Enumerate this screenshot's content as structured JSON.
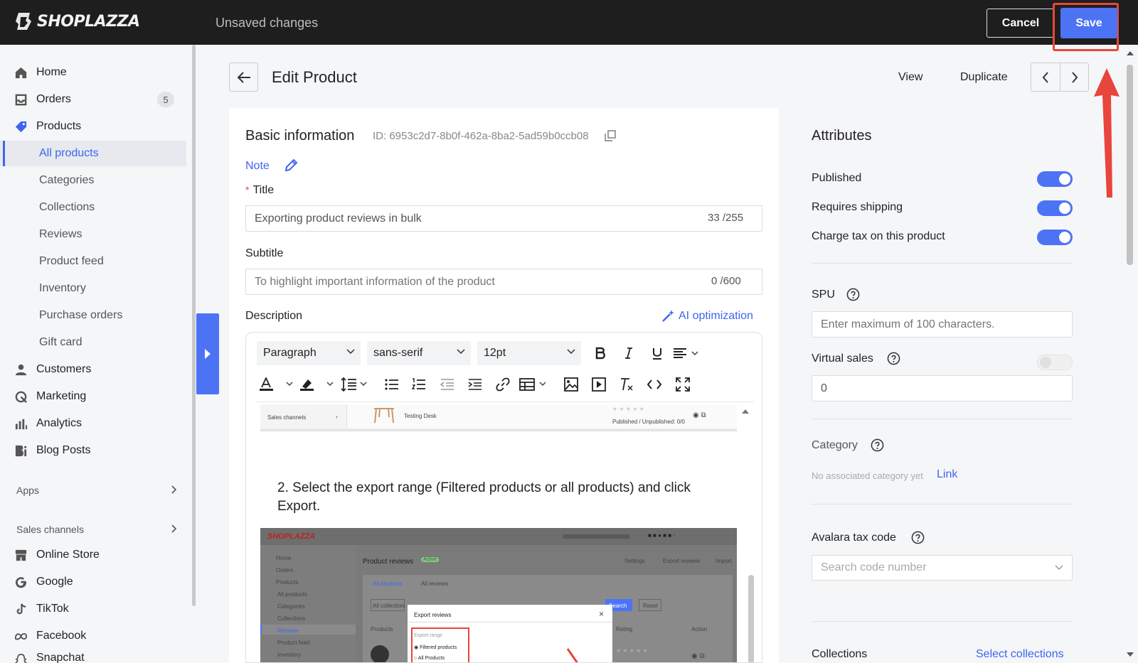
{
  "topbar": {
    "logo_text": "SHOPLAZZA",
    "status": "Unsaved changes",
    "cancel_label": "Cancel",
    "save_label": "Save"
  },
  "sidebar": {
    "items": [
      {
        "label": "Home",
        "icon": "home-icon"
      },
      {
        "label": "Orders",
        "icon": "orders-icon",
        "badge": "5"
      },
      {
        "label": "Products",
        "icon": "tag-icon"
      }
    ],
    "product_subitems": [
      "All products",
      "Categories",
      "Collections",
      "Reviews",
      "Product feed",
      "Inventory",
      "Purchase orders",
      "Gift card"
    ],
    "items2": [
      {
        "label": "Customers",
        "icon": "person-icon"
      },
      {
        "label": "Marketing",
        "icon": "marketing-icon"
      },
      {
        "label": "Analytics",
        "icon": "analytics-icon"
      },
      {
        "label": "Blog Posts",
        "icon": "blog-icon"
      }
    ],
    "apps_label": "Apps",
    "sales_channels_label": "Sales channels",
    "channels": [
      {
        "label": "Online Store",
        "icon": "store-icon"
      },
      {
        "label": "Google",
        "icon": "google-icon"
      },
      {
        "label": "TikTok",
        "icon": "tiktok-icon"
      },
      {
        "label": "Facebook",
        "icon": "meta-icon"
      },
      {
        "label": "Snapchat",
        "icon": "snapchat-icon"
      }
    ]
  },
  "header": {
    "title": "Edit Product",
    "view_label": "View",
    "duplicate_label": "Duplicate"
  },
  "basic": {
    "title": "Basic information",
    "id_text": "ID: 6953c2d7-8b0f-462a-8ba2-5ad59b0ccb08",
    "note_label": "Note",
    "title_label": "Title",
    "title_value": "Exporting product reviews in bulk",
    "title_counter": "33 /255",
    "subtitle_label": "Subtitle",
    "subtitle_placeholder": "To highlight important information of the product",
    "subtitle_counter": "0 /600",
    "description_label": "Description",
    "ai_label": "AI optimization"
  },
  "editor": {
    "paragraph_format": "Paragraph",
    "font_family": "sans-serif",
    "font_size": "12pt",
    "step_text": "2. Select the export range (Filtered products or all products) and click Export.",
    "shot1": {
      "sidebar_text": "Sales channels",
      "row_text": "Testing Desk",
      "status_text": "Published / Unpublished: 0/0"
    },
    "shot2": {
      "logo": "SHOPLAZZA",
      "title": "Product reviews",
      "badge": "Active",
      "settings": "Settings",
      "export": "Export reviews",
      "import": "Import",
      "nav": [
        "Home",
        "Orders",
        "Products",
        "All products",
        "Categories",
        "Collections",
        "Reviews",
        "Product feed",
        "Inventory"
      ],
      "tab1": "All products",
      "tab2": "All reviews",
      "filter": "All collection",
      "search": "Search",
      "reset": "Reset",
      "col_products": "Products",
      "col_rating": "Rating",
      "col_action": "Action",
      "dialog_title": "Export reviews",
      "export_range": "Export range",
      "opt1": "Filtered products",
      "opt2": "All Products"
    }
  },
  "attributes": {
    "title": "Attributes",
    "published_label": "Published",
    "shipping_label": "Requires shipping",
    "tax_label": "Charge tax on this product",
    "spu_label": "SPU",
    "spu_placeholder": "Enter maximum of 100 characters.",
    "virtual_label": "Virtual sales",
    "virtual_value": "0",
    "category_label": "Category",
    "category_empty": "No associated category yet",
    "category_link": "Link",
    "avalara_label": "Avalara tax code",
    "avalara_placeholder": "Search code number",
    "collections_label": "Collections",
    "collections_link": "Select collections"
  },
  "colors": {
    "accent": "#4d73f5",
    "highlight": "#e8453c",
    "topbar": "#1e1e1e"
  }
}
